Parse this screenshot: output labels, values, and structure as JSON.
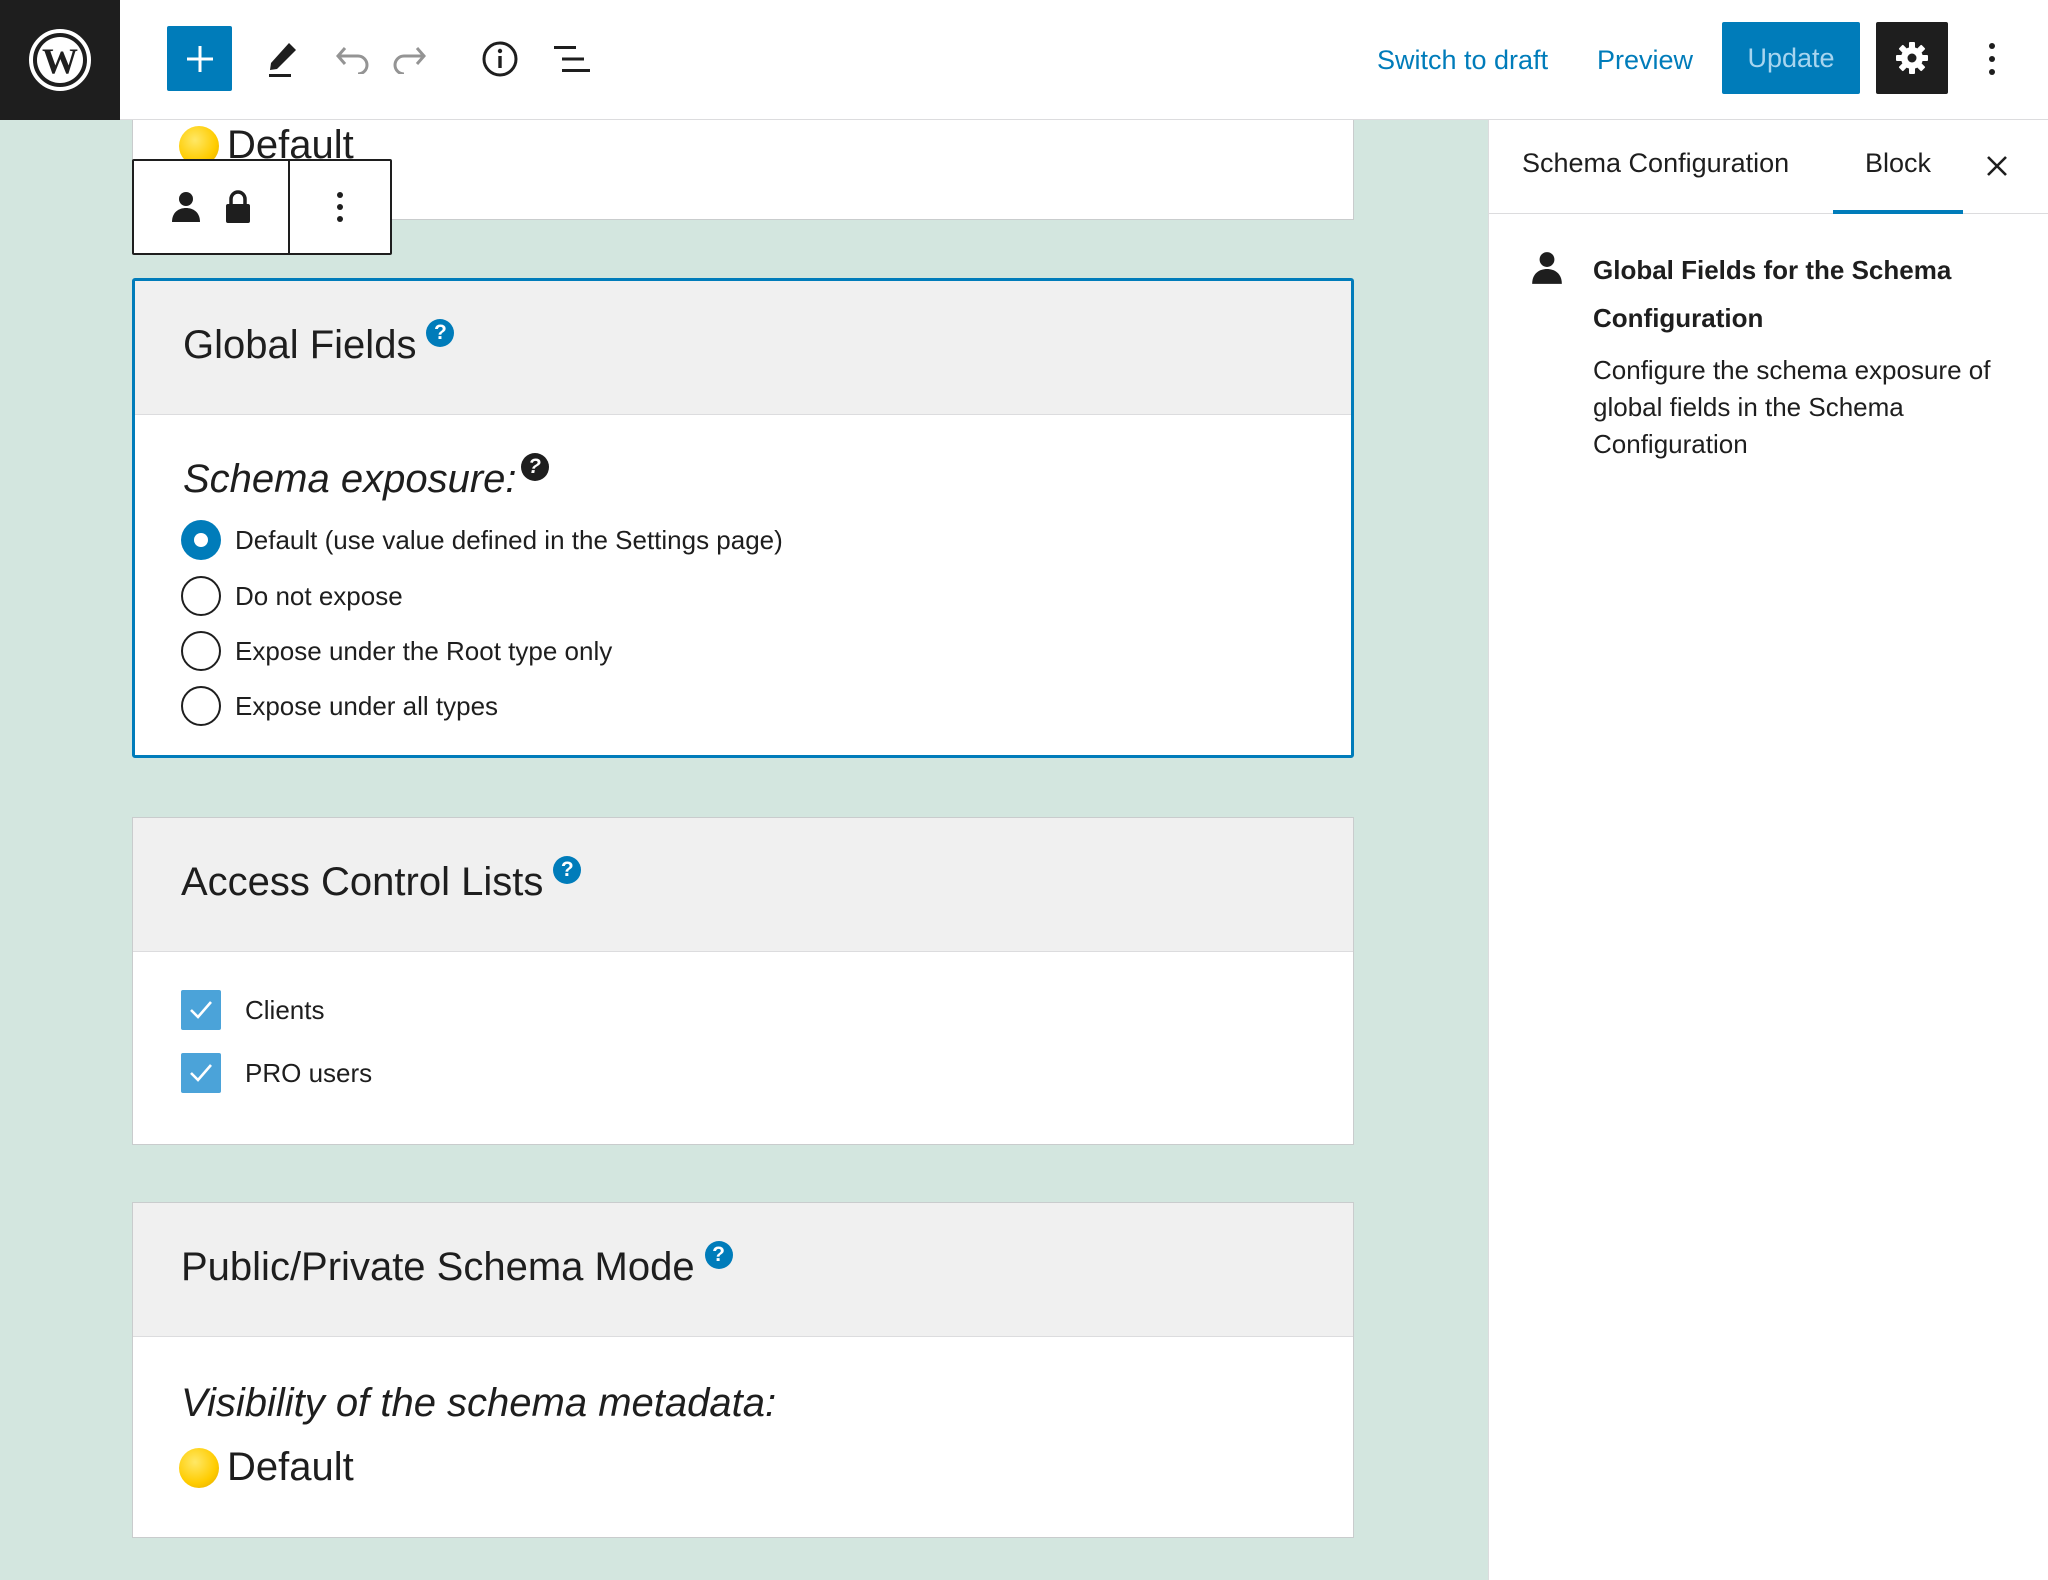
{
  "toolbar": {
    "switch_to_draft": "Switch to draft",
    "preview": "Preview",
    "update": "Update",
    "icons": [
      "wordpress-logo-icon",
      "plus-icon",
      "pencil-icon",
      "undo-icon",
      "redo-icon",
      "info-icon",
      "list-view-icon",
      "gear-icon",
      "vertical-dots-icon"
    ]
  },
  "canvas": {
    "top_partial_block": {
      "value": "Default"
    },
    "block_toolbar": {
      "icons": [
        "user-icon",
        "lock-icon",
        "vertical-dots-icon"
      ]
    },
    "global_fields": {
      "title": "Global Fields",
      "help": "?",
      "subtitle": "Schema exposure:",
      "subtitle_help": "?",
      "options": [
        {
          "label": "Default (use value defined in the Settings page)",
          "checked": true
        },
        {
          "label": "Do not expose",
          "checked": false
        },
        {
          "label": "Expose under the Root type only",
          "checked": false
        },
        {
          "label": "Expose under all types",
          "checked": false
        }
      ]
    },
    "access_control_lists": {
      "title": "Access Control Lists",
      "help": "?",
      "items": [
        {
          "label": "Clients",
          "checked": true
        },
        {
          "label": "PRO users",
          "checked": true
        }
      ]
    },
    "public_private_mode": {
      "title": "Public/Private Schema Mode",
      "help": "?",
      "subtitle": "Visibility of the schema metadata:",
      "value": "Default"
    }
  },
  "sidebar": {
    "tabs": [
      "Schema Configuration",
      "Block"
    ],
    "active_tab": "Block",
    "block_title": "Global Fields for the Schema Configuration",
    "block_description": "Configure the schema exposure of global fields in the Schema Configuration"
  },
  "colors": {
    "accent": "#007cba",
    "canvas_bg": "#d3e6df",
    "checkbox": "#4ba3d9",
    "dark": "#1e1e1e"
  }
}
